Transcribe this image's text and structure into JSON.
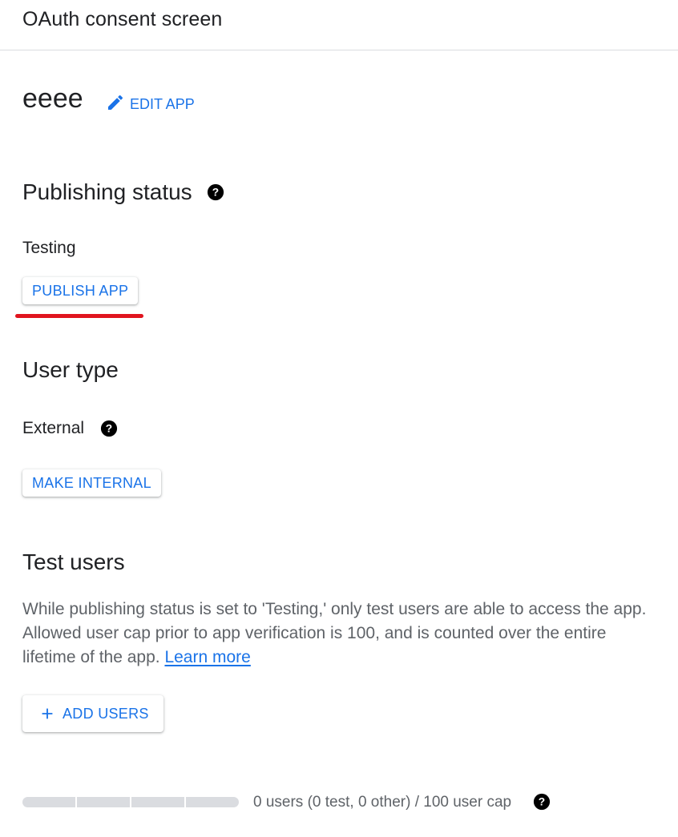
{
  "header": {
    "title": "OAuth consent screen"
  },
  "app": {
    "name": "eeee",
    "edit_label": "EDIT APP"
  },
  "publishing": {
    "title": "Publishing status",
    "status": "Testing",
    "publish_label": "PUBLISH APP"
  },
  "user_type": {
    "title": "User type",
    "value": "External",
    "make_internal_label": "MAKE INTERNAL"
  },
  "test_users": {
    "title": "Test users",
    "description": "While publishing status is set to 'Testing,' only test users are able to access the app. Allowed user cap prior to app verification is 100, and is counted over the entire lifetime of the app.",
    "learn_more": "Learn more",
    "add_users_label": "ADD USERS",
    "cap_text": "0 users (0 test, 0 other) / 100 user cap",
    "usage_fraction": 0
  },
  "colors": {
    "accent": "#1a73e8",
    "highlight_underline": "#e0141e",
    "bar": "#dadce0"
  },
  "icons": [
    "pencil-icon",
    "help-icon",
    "plus-icon"
  ]
}
